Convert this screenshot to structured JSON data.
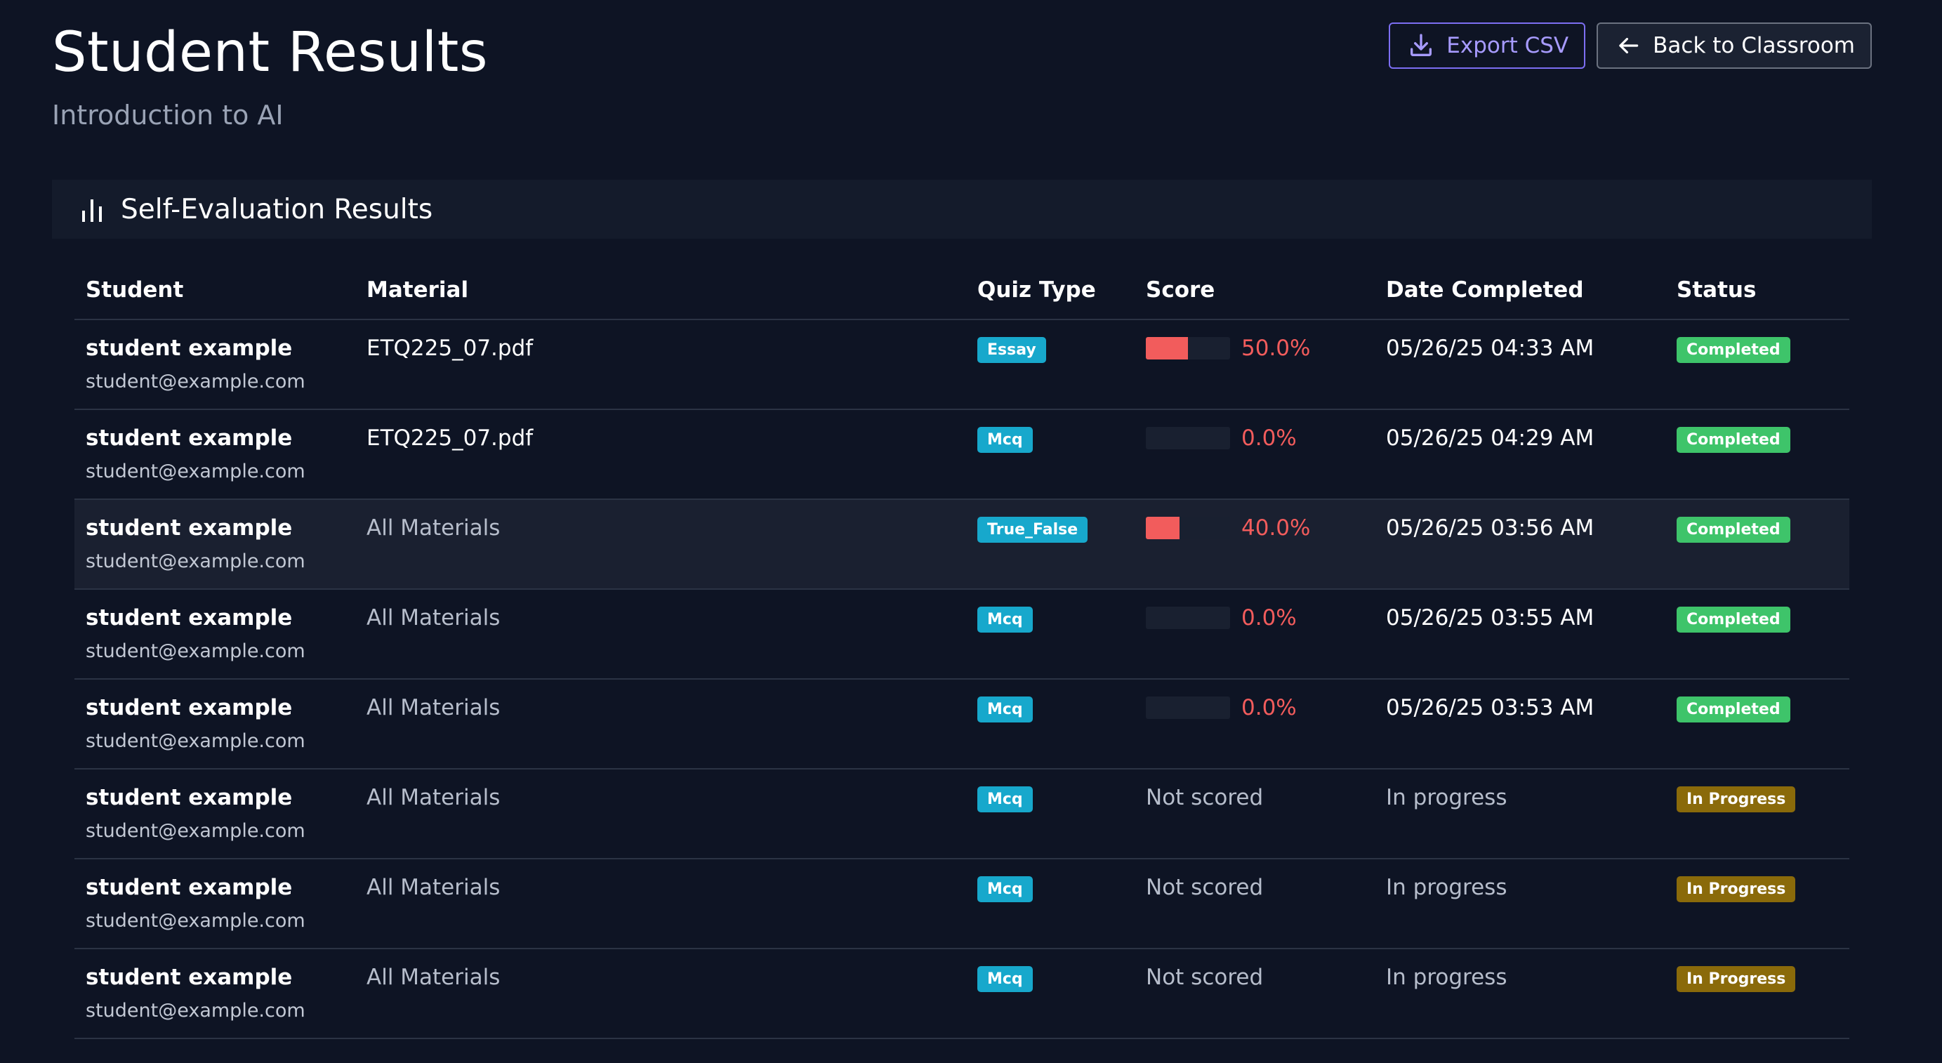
{
  "header": {
    "title": "Student Results",
    "subtitle": "Introduction to AI",
    "export_label": "Export CSV",
    "back_label": "Back to Classroom"
  },
  "section": {
    "title": "Self-Evaluation Results",
    "icon": "bar-chart-icon"
  },
  "table": {
    "columns": [
      "Student",
      "Material",
      "Quiz Type",
      "Score",
      "Date Completed",
      "Status"
    ],
    "rows": [
      {
        "name": "student example",
        "email": "student@example.com",
        "material": "ETQ225_07.pdf",
        "quiz_type": "Essay",
        "score": "50.0%",
        "score_value": 0.5,
        "date": "05/26/25 04:33 AM",
        "status": "Completed"
      },
      {
        "name": "student example",
        "email": "student@example.com",
        "material": "ETQ225_07.pdf",
        "quiz_type": "Mcq",
        "score": "0.0%",
        "score_value": 0.0,
        "date": "05/26/25 04:29 AM",
        "status": "Completed"
      },
      {
        "name": "student example",
        "email": "student@example.com",
        "material": "All Materials",
        "quiz_type": "True_False",
        "score": "40.0%",
        "score_value": 0.4,
        "date": "05/26/25 03:56 AM",
        "status": "Completed"
      },
      {
        "name": "student example",
        "email": "student@example.com",
        "material": "All Materials",
        "quiz_type": "Mcq",
        "score": "0.0%",
        "score_value": 0.0,
        "date": "05/26/25 03:55 AM",
        "status": "Completed"
      },
      {
        "name": "student example",
        "email": "student@example.com",
        "material": "All Materials",
        "quiz_type": "Mcq",
        "score": "0.0%",
        "score_value": 0.0,
        "date": "05/26/25 03:53 AM",
        "status": "Completed"
      },
      {
        "name": "student example",
        "email": "student@example.com",
        "material": "All Materials",
        "quiz_type": "Mcq",
        "score": "Not scored",
        "score_value": null,
        "date": "In progress",
        "status": "In Progress"
      },
      {
        "name": "student example",
        "email": "student@example.com",
        "material": "All Materials",
        "quiz_type": "Mcq",
        "score": "Not scored",
        "score_value": null,
        "date": "In progress",
        "status": "In Progress"
      },
      {
        "name": "student example",
        "email": "student@example.com",
        "material": "All Materials",
        "quiz_type": "Mcq",
        "score": "Not scored",
        "score_value": null,
        "date": "In progress",
        "status": "In Progress"
      }
    ]
  },
  "colors": {
    "background": "#0e1424",
    "accent": "#7c6ef2",
    "score_red": "#f25c5c",
    "quiz_badge": "#17a8cc",
    "completed_badge": "#3ec46a",
    "progress_badge": "#8a6a0a"
  }
}
